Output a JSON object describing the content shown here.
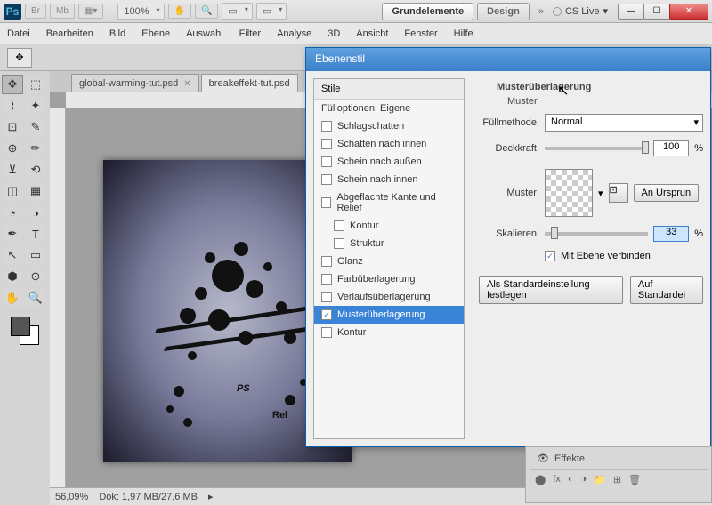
{
  "titlebar": {
    "ps": "Ps",
    "br": "Br",
    "mb": "Mb",
    "zoom": "100%",
    "workspace1": "Grundelemente",
    "workspace2": "Design",
    "more": "»",
    "cslive": "CS Live"
  },
  "menu": {
    "datei": "Datei",
    "bearbeiten": "Bearbeiten",
    "bild": "Bild",
    "ebene": "Ebene",
    "auswahl": "Auswahl",
    "filter": "Filter",
    "analyse": "Analyse",
    "d3": "3D",
    "ansicht": "Ansicht",
    "fenster": "Fenster",
    "hilfe": "Hilfe"
  },
  "tabs": {
    "t1": "global-warming-tut.psd",
    "t2": "breakeffekt-tut.psd"
  },
  "status": {
    "zoom": "56,09%",
    "doc": "Dok: 1,97 MB/27,6 MB"
  },
  "dialog": {
    "title": "Ebenenstil",
    "styles_head": "Stile",
    "fill_opts": "Fülloptionen: Eigene",
    "items": {
      "schlagschatten": "Schlagschatten",
      "schatten_innen": "Schatten nach innen",
      "schein_aussen": "Schein nach außen",
      "schein_innen": "Schein nach innen",
      "abgeflachte": "Abgeflachte Kante und Relief",
      "kontur1": "Kontur",
      "struktur": "Struktur",
      "glanz": "Glanz",
      "farbueber": "Farbüberlagerung",
      "verlaufueber": "Verlaufsüberlagerung",
      "musterueber": "Musterüberlagerung",
      "kontur2": "Kontur"
    },
    "section": "Musterüberlagerung",
    "subsection": "Muster",
    "blend_label": "Füllmethode:",
    "blend_value": "Normal",
    "opacity_label": "Deckkraft:",
    "opacity_value": "100",
    "opacity_unit": "%",
    "pattern_label": "Muster:",
    "snap_btn": "An Ursprun",
    "scale_label": "Skalieren:",
    "scale_value": "33",
    "scale_unit": "%",
    "link_layer": "Mit Ebene verbinden",
    "btn_default": "Als Standardeinstellung festlegen",
    "btn_reset": "Auf Standardei"
  },
  "panel": {
    "effekte": "Effekte",
    "link": "⬤",
    "fx": "fx"
  },
  "canvas_text": "Rel"
}
